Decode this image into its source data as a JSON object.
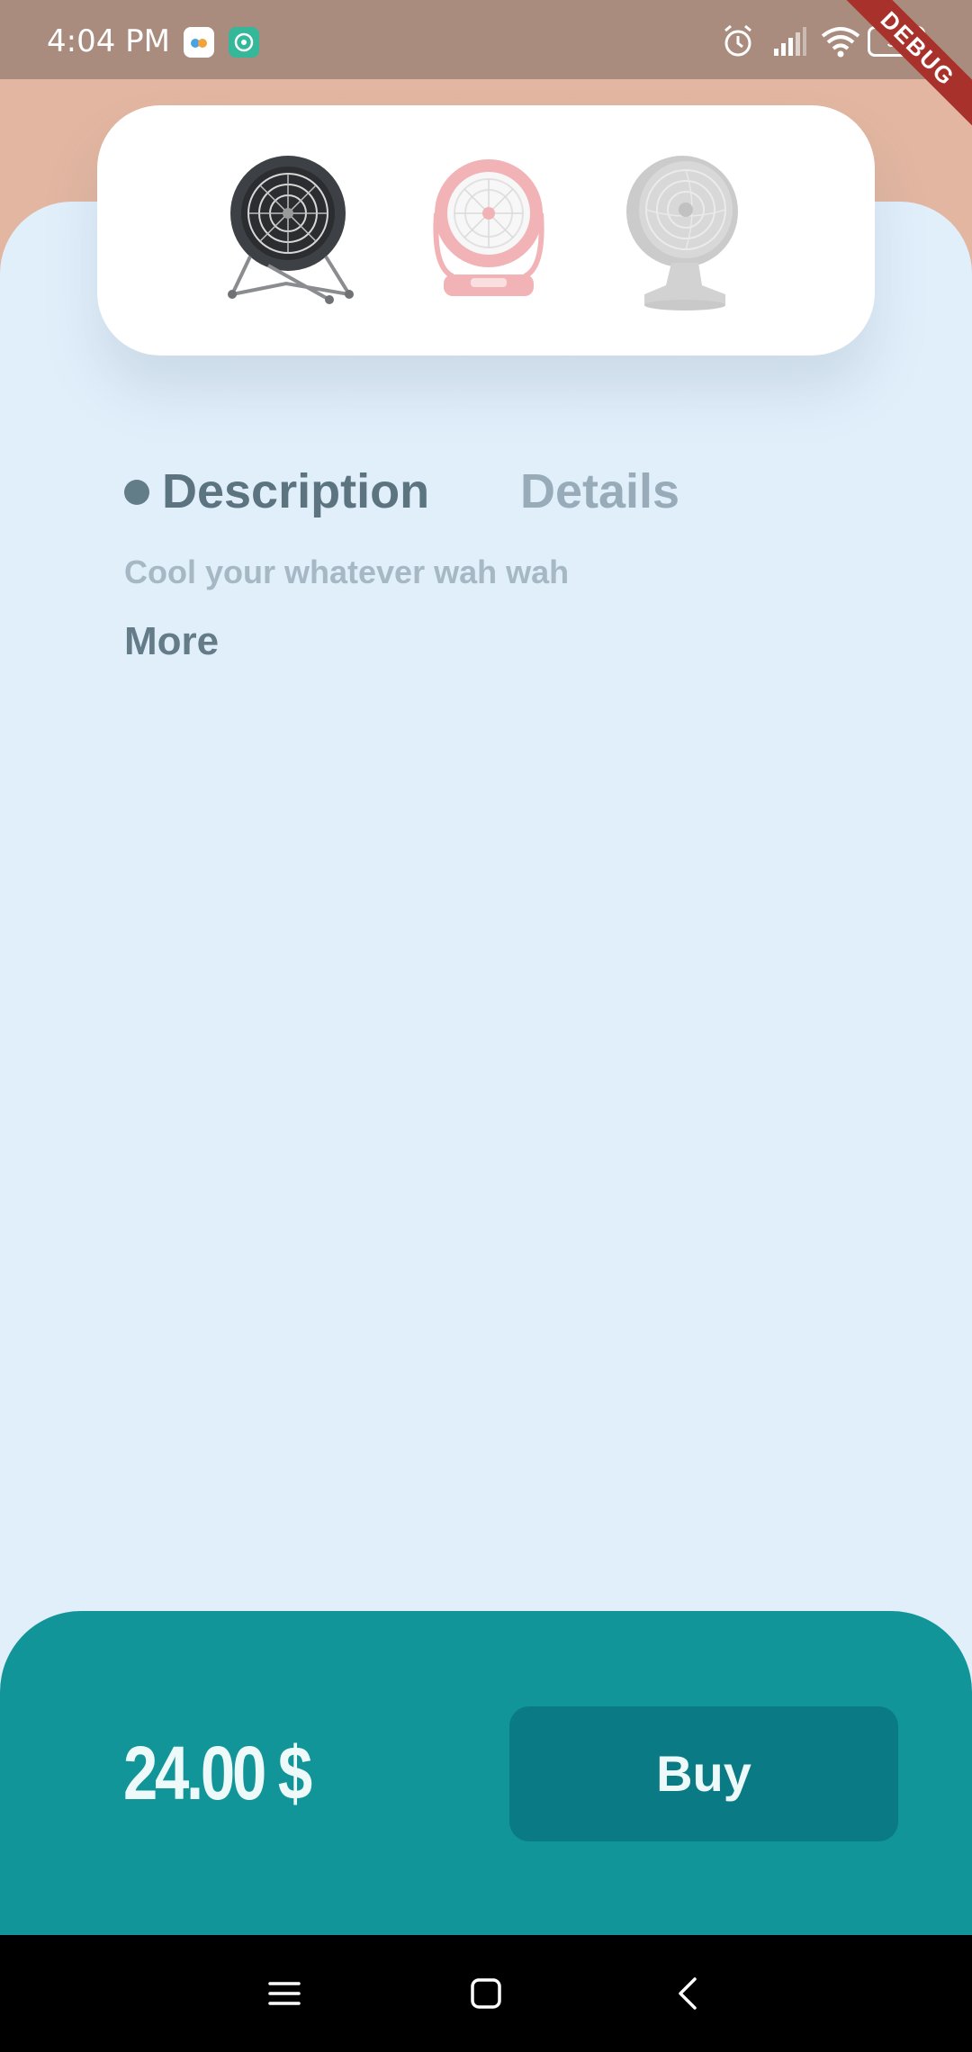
{
  "status_bar": {
    "time": "4:04 PM",
    "battery": "94",
    "icons": [
      "app-icon-99",
      "app-icon-radio",
      "alarm-icon",
      "signal-icon",
      "wifi-icon",
      "battery-icon"
    ]
  },
  "debug_banner": "DEBUG",
  "carousel": {
    "items": [
      "black-fan-image",
      "pink-fan-image",
      "gray-fan-image"
    ],
    "active_index": 0
  },
  "tabs": {
    "active": "Description",
    "description_label": "Description",
    "details_label": "Details"
  },
  "description": {
    "text": "Cool your whatever wah wah",
    "more_label": "More"
  },
  "purchase": {
    "price": "24.00 $",
    "buy_label": "Buy"
  },
  "colors": {
    "header_bg": "#e2b6a0",
    "panel_bg": "#e1effb",
    "bottom_bar": "#119599",
    "buy_button": "#0a7a85",
    "active_tab": "#5b7480",
    "inactive_tab": "#97acb8"
  },
  "nav_bar": {
    "buttons": [
      "menu-icon",
      "home-icon",
      "back-icon"
    ]
  }
}
